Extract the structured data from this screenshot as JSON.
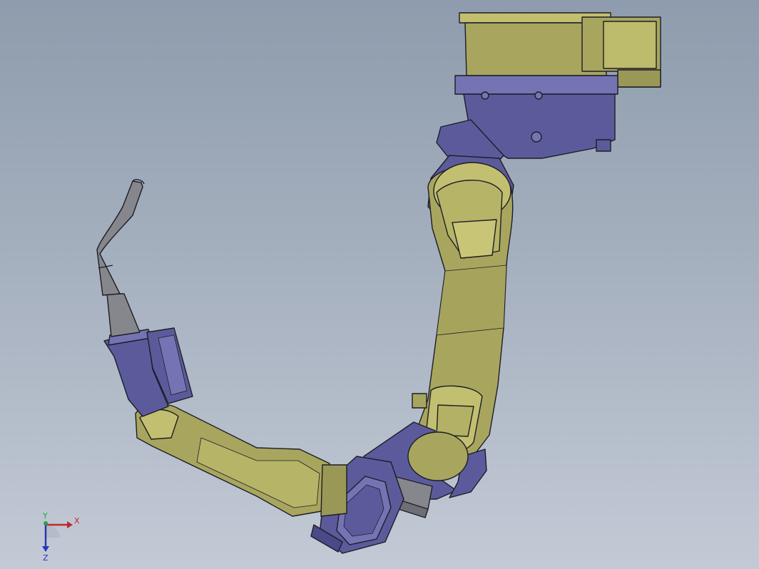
{
  "viewport": {
    "background_top": "#8e9cad",
    "background_bottom": "#c3cad6"
  },
  "model": {
    "colors": {
      "yellow_link": "#a8a65e",
      "yellow_link_light": "#c2c070",
      "blue_joint": "#5b5b9c",
      "blue_joint_light": "#7474b4",
      "torch_gray": "#86878d",
      "edge": "#1d1d26"
    }
  },
  "triad": {
    "x_label": "X",
    "y_label": "Y",
    "z_label": "Z",
    "x_color": "#c0282a",
    "y_color": "#2aa043",
    "z_color": "#2836b8"
  }
}
